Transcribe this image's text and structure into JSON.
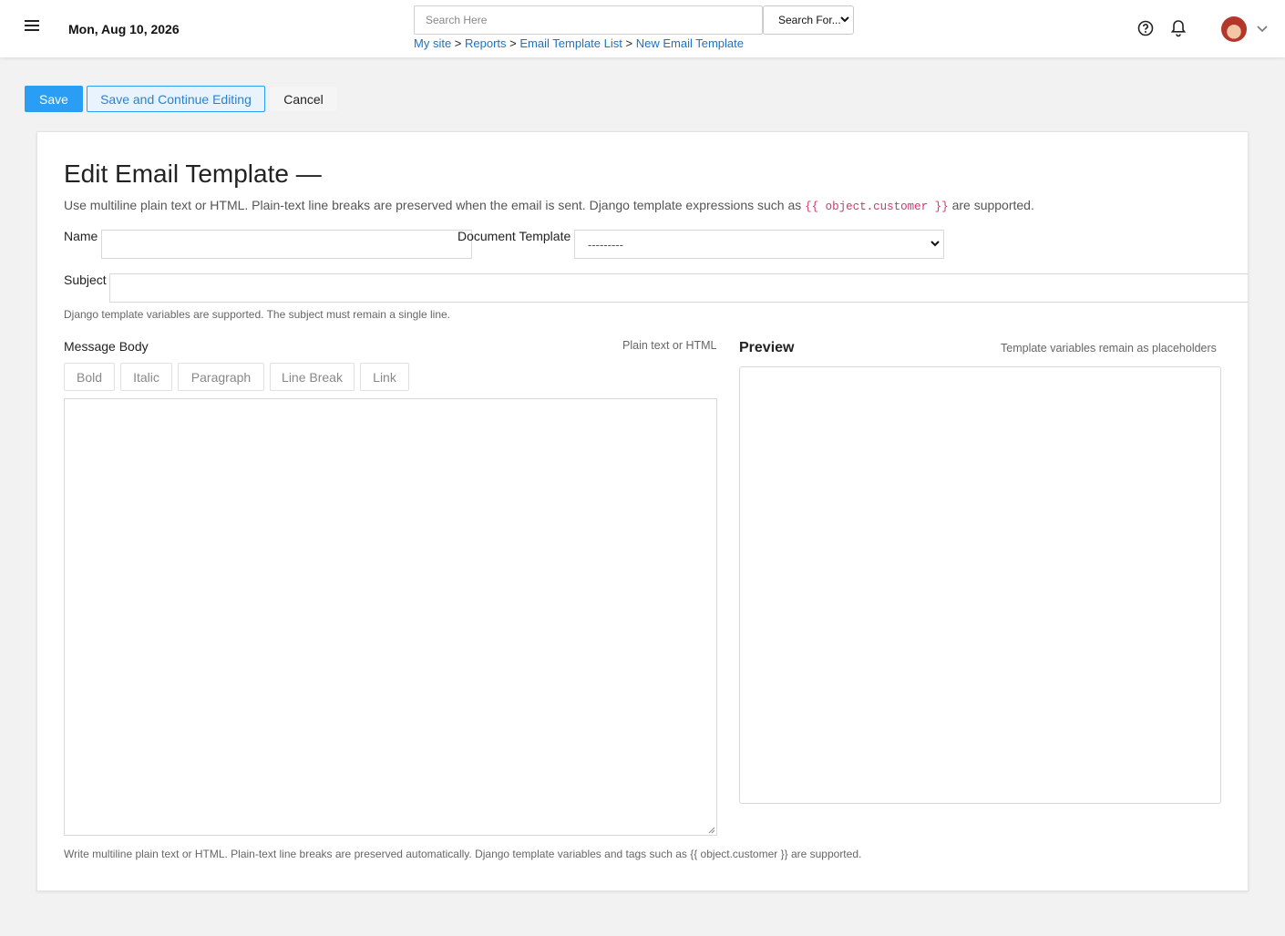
{
  "header": {
    "date": "Mon, Aug 10, 2026",
    "search_placeholder": "Search Here",
    "search_for": "Search For...",
    "breadcrumb": {
      "items": [
        "My site",
        "Reports",
        "Email Template List",
        "New Email Template"
      ],
      "separator": ">"
    }
  },
  "actions": {
    "save": "Save",
    "save_continue": "Save and Continue Editing",
    "cancel": "Cancel"
  },
  "form": {
    "title": "Edit Email Template —",
    "intro_before": "Use multiline plain text or HTML. Plain-text line breaks are preserved when the email is sent. Django template expressions such as",
    "intro_code": "{{ object.customer }}",
    "intro_after": "are supported.",
    "name_label": "Name",
    "name_value": "",
    "document_template_label": "Document Template",
    "document_template_value": "---------",
    "subject_label": "Subject",
    "subject_value": "",
    "subject_hint": "Django template variables are supported. The subject must remain a single line.",
    "message_body_label": "Message Body",
    "message_body_format": "Plain text or HTML",
    "toolbar": [
      "Bold",
      "Italic",
      "Paragraph",
      "Line Break",
      "Link"
    ],
    "message_body_value": "",
    "message_body_hint": "Write multiline plain text or HTML. Plain-text line breaks are preserved automatically. Django template variables and tags such as {{ object.customer }} are supported.",
    "preview_label": "Preview",
    "preview_hint": "Template variables remain as placeholders"
  },
  "colors": {
    "primary": "#2a9df4",
    "link": "#1a73c9",
    "code": "#d6336c",
    "background": "#f2f2f2"
  },
  "icons": [
    "menu-icon",
    "help-icon",
    "bell-icon",
    "avatar",
    "chevron-down-icon"
  ]
}
